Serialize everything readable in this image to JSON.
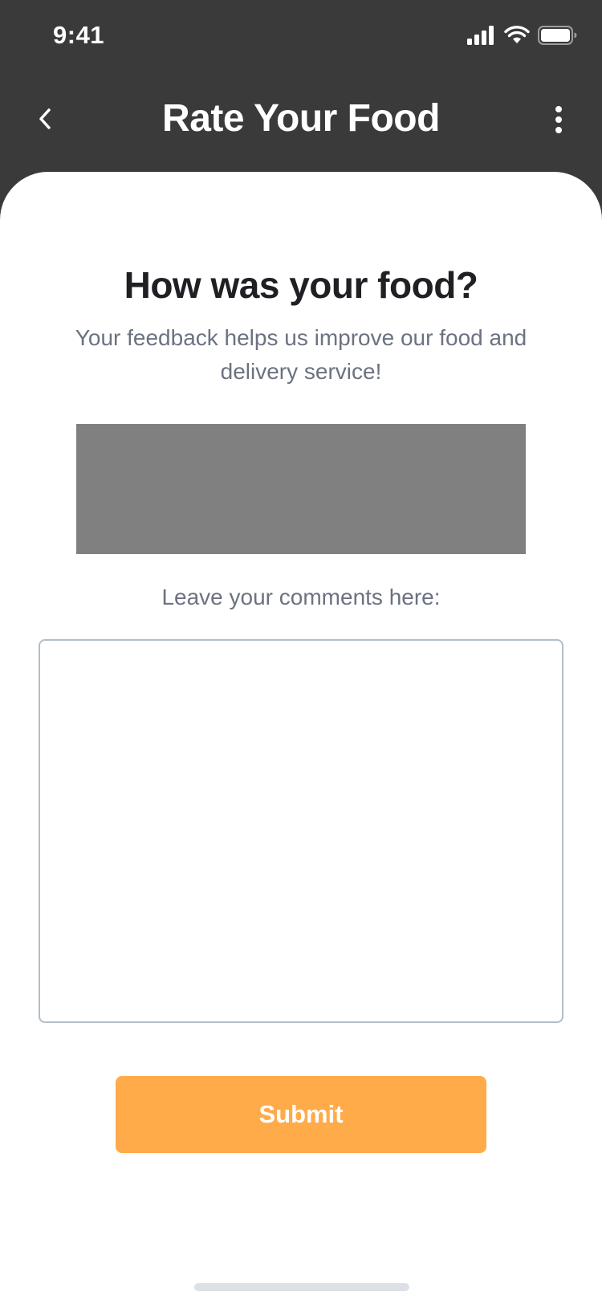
{
  "status_bar": {
    "time": "9:41",
    "icons": [
      "cellular-signal-icon",
      "wifi-icon",
      "battery-icon"
    ]
  },
  "header": {
    "title": "Rate Your Food",
    "back_icon": "chevron-left-icon",
    "more_icon": "more-vertical-icon"
  },
  "content": {
    "question": "How was your food?",
    "subtitle": "Your feedback helps us improve our food and delivery service!",
    "comments_label": "Leave your comments here:",
    "comments_value": "",
    "submit_label": "Submit"
  },
  "colors": {
    "header_bg": "#3a3a3a",
    "card_bg": "#ffffff",
    "title_text": "#1f2024",
    "muted_text": "#6b7280",
    "accent": "#ffab4a",
    "field_border": "#b4bec9",
    "placeholder_gray": "#808080"
  }
}
